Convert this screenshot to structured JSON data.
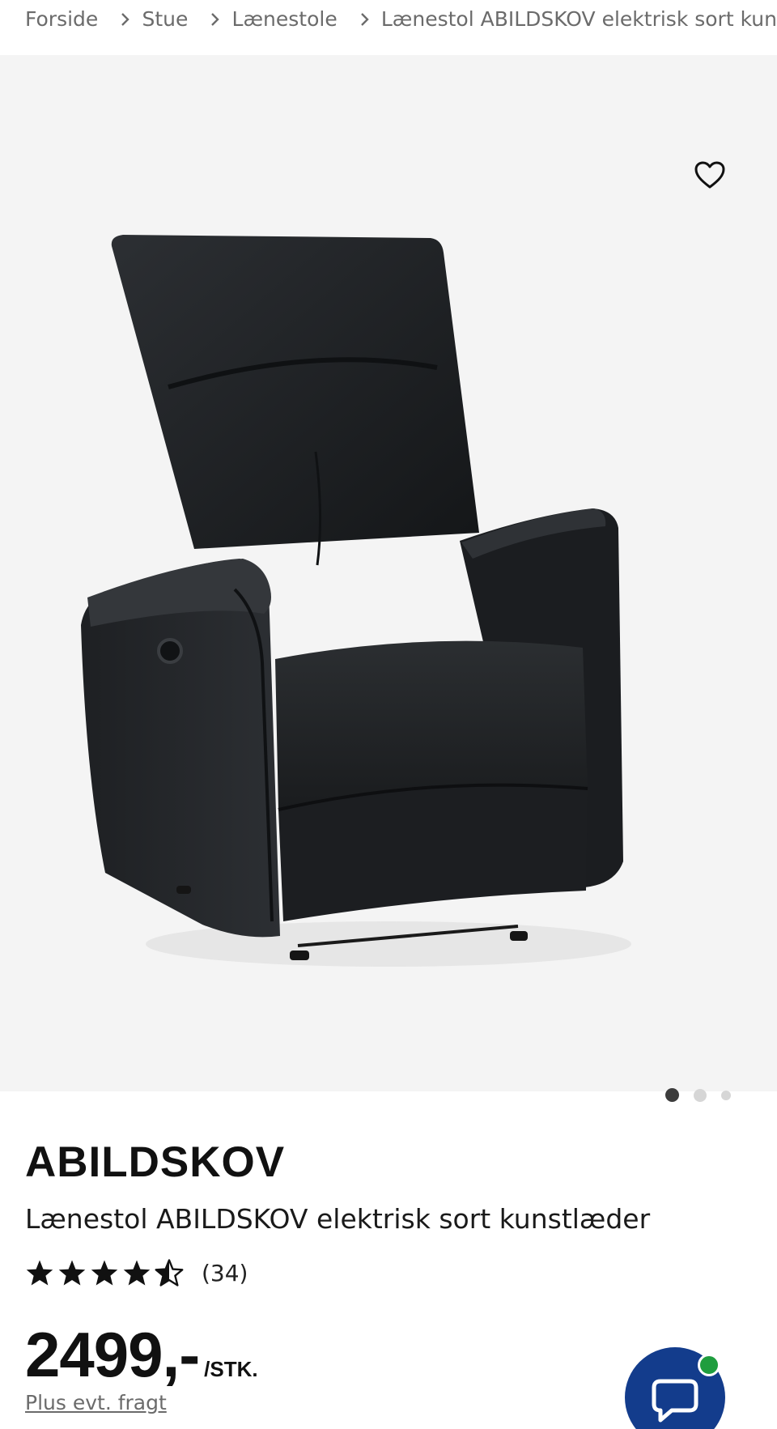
{
  "breadcrumb": {
    "items": [
      {
        "label": "Forside"
      },
      {
        "label": "Stue"
      },
      {
        "label": "Lænestole"
      },
      {
        "label": "Lænestol ABILDSKOV elektrisk sort kun"
      }
    ]
  },
  "gallery": {
    "wishlist_icon": "heart-outline-icon",
    "image_count": 3,
    "active_index": 0
  },
  "product": {
    "brand": "ABILDSKOV",
    "title": "Lænestol ABILDSKOV elektrisk sort kunstlæder",
    "rating": 4.5,
    "rating_max": 5,
    "rating_count": "(34)",
    "price": "2499,-",
    "price_unit": "/STK.",
    "shipping_note": "Plus evt. fragt"
  },
  "chat": {
    "icon": "chat-bubble-icon",
    "status_color": "#1f9d3e",
    "button_color": "#133c8c"
  }
}
